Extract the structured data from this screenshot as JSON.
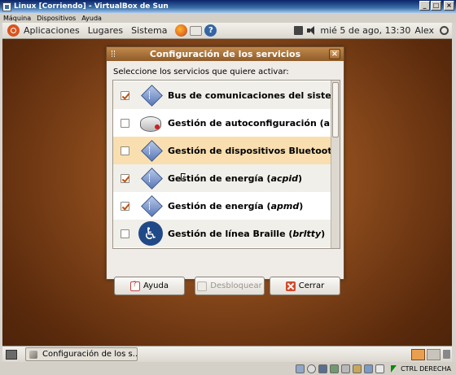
{
  "vbox": {
    "title": "Linux [Corriendo] - VirtualBox de Sun",
    "menu": [
      "Máquina",
      "Dispositivos",
      "Ayuda"
    ],
    "status_text": "CTRL DERECHA"
  },
  "top_panel": {
    "menus": [
      "Aplicaciones",
      "Lugares",
      "Sistema"
    ],
    "datetime": "mié  5 de ago, 13:30",
    "user": "Alex"
  },
  "dialog": {
    "title": "Configuración de los servicios",
    "prompt": "Seleccione los servicios que quiere activar:",
    "services": [
      {
        "label": "Bus de comunicaciones del siste",
        "suffix": "",
        "checked": true,
        "icon": "gear-diamond-icon"
      },
      {
        "label": "Gestión de autoconfiguración (a",
        "suffix": "",
        "checked": false,
        "icon": "drive-icon"
      },
      {
        "label": "Gestión de dispositivos Bluetoot",
        "suffix": "",
        "checked": false,
        "icon": "gear-diamond-icon"
      },
      {
        "label": "Gestión de energía (",
        "suffix": "acpid",
        "close": ")",
        "checked": true,
        "icon": "gear-diamond-icon"
      },
      {
        "label": "Gestión de energía (",
        "suffix": "apmd",
        "close": ")",
        "checked": true,
        "icon": "gear-diamond-icon"
      },
      {
        "label": "Gestión de línea Braille (",
        "suffix": "brltty",
        "close": ")",
        "checked": false,
        "icon": "accessibility-icon"
      }
    ],
    "buttons": {
      "help": "Ayuda",
      "unlock": "Desbloquear",
      "close": "Cerrar"
    }
  },
  "bottom_panel": {
    "task": "Configuración de los s..."
  },
  "colors": {
    "accent": "#d9531e",
    "highlight": "#f9dfaf",
    "check": "#c0510e"
  }
}
